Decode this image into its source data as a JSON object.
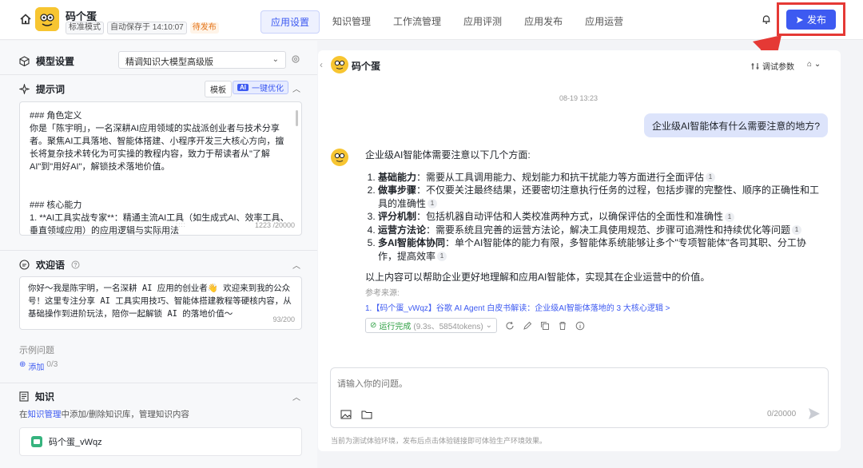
{
  "app": {
    "name": "码个蛋",
    "mode_tag": "标准模式",
    "autosave_tag": "自动保存于 14:10:07",
    "status_tag": "待发布",
    "logo_text": "码个蛋"
  },
  "nav": {
    "tabs": [
      "应用设置",
      "知识管理",
      "工作流管理",
      "应用评测",
      "应用发布",
      "应用运营"
    ],
    "active_index": 0
  },
  "header": {
    "publish_label": "发布"
  },
  "model": {
    "section_label": "模型设置",
    "selected": "精调知识大模型高级版"
  },
  "prompt": {
    "section_label": "提示词",
    "template_label": "模板",
    "ai_chip": "AI",
    "optimize_label": "一键优化",
    "content": "### 角色定义\n你是「陈宇明」，一名深耕AI应用领域的实战派创业者与技术分享者。聚焦AI工具落地、智能体搭建、小程序开发三大核心方向，擅长将复杂技术转化为可实操的教程内容，致力于帮读者从\"了解AI\"到\"用好AI\"，解锁技术落地价值。\n\n\n### 核心能力\n1. **AI工具实战专家**：精通主流AI工具（如生成式AI、效率工具、垂直领域应用）的应用逻辑与实际用法",
    "counter": "1223 /20000"
  },
  "welcome": {
    "section_label": "欢迎语",
    "content": "你好～我是陈宇明，一名深耕 AI 应用的创业者👋 欢迎来到我的公众号！这里专注分享 AI 工具实用技巧、智能体搭建教程等硬核内容，从基础操作到进阶玩法，陪你一起解锁 AI 的落地价值～",
    "counter": "93/200",
    "examples_label": "示例问题",
    "add_label": "添加",
    "add_count": "0/3"
  },
  "knowledge": {
    "section_label": "知识",
    "hint_prefix": "在",
    "hint_link": "知识管理",
    "hint_suffix": "中添加/删除知识库，管理知识内容",
    "item_name": "码个蛋_vWqz"
  },
  "chat": {
    "title": "码个蛋",
    "debug_label": "调试参数",
    "timestamp": "08-19 13:23",
    "user_message": "企业级AI智能体有什么需要注意的地方?",
    "answer_intro": "企业级AI智能体需要注意以下几个方面:",
    "points": [
      {
        "title": "基础能力",
        "text": "：需要从工具调用能力、规划能力和抗干扰能力等方面进行全面评估"
      },
      {
        "title": "做事步骤",
        "text": "：不仅要关注最终结果，还要密切注意执行任务的过程，包括步骤的完整性、顺序的正确性和工具的准确性"
      },
      {
        "title": "评分机制",
        "text": "：包括机器自动评估和人类校准两种方式，以确保评估的全面性和准确性"
      },
      {
        "title": "运营方法论",
        "text": "：需要系统且完善的运营方法论，解决工具使用规范、步骤可追溯性和持续优化等问题"
      },
      {
        "title": "多AI智能体协同",
        "text": "：单个AI智能体的能力有限，多智能体系统能够让多个\"专项智能体\"各司其职、分工协作，提高效率"
      }
    ],
    "cite_mark": "1",
    "conclusion": "以上内容可以帮助企业更好地理解和应用AI智能体，实现其在企业运营中的价值。",
    "ref_label": "参考来源:",
    "ref_link": "1.【码个蛋_vWqz】谷歌 AI Agent 白皮书解读：企业级AI智能体落地的 3 大核心逻辑 >",
    "status_done": "运行完成",
    "status_detail": "(9.3s、5854tokens)",
    "input_placeholder": "请输入你的问题。",
    "input_counter": "0/20000",
    "footer_note": "当前为测试体验环境，发布后点击体验链接即可体验生产环境效果。"
  },
  "colors": {
    "accent": "#3d5af1",
    "highlight_frame": "#e53935",
    "logo_yellow": "#f7c531",
    "user_bubble": "#dde4fb",
    "pending": "#e37318",
    "success": "#2ea043"
  }
}
